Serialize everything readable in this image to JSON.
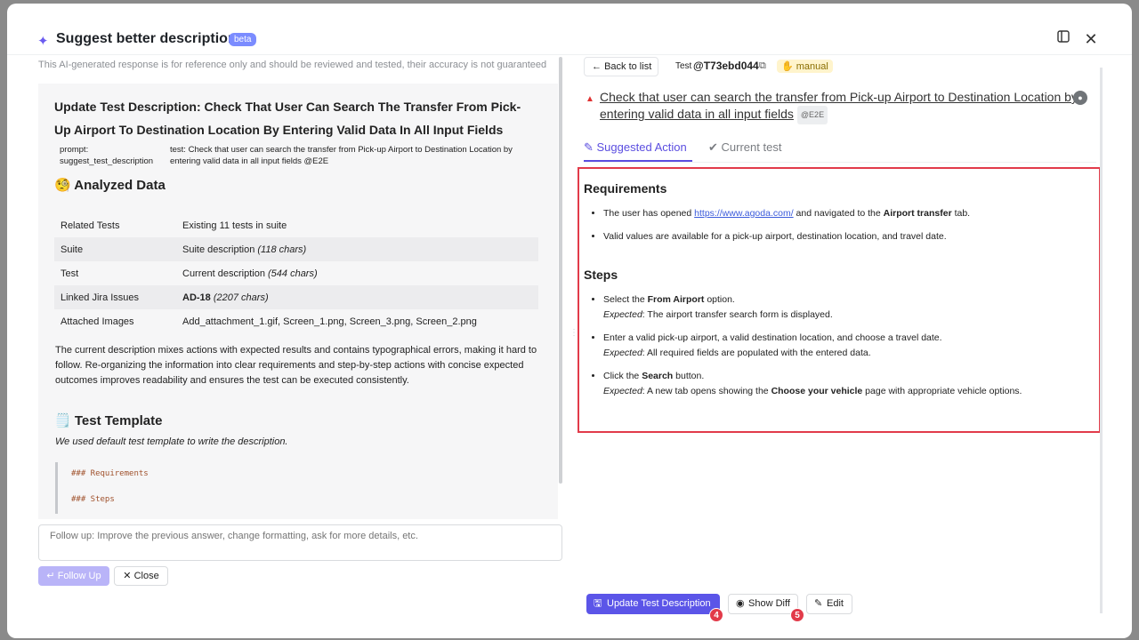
{
  "header": {
    "title": "Suggest better description",
    "beta_label": "beta",
    "panel_icon": "panel-icon",
    "close_icon": "close-icon"
  },
  "left": {
    "disclaimer": "This AI-generated response is for reference only and should be reviewed and tested, their accuracy is not guaranteed",
    "heading": "Update Test Description: Check That User Can Search The Transfer From Pick-Up Airport To Destination Location By Entering Valid Data In All Input Fields",
    "prompt_key": "prompt: suggest_test_description",
    "prompt_value": "test: Check that user can search the transfer from Pick-up Airport to Destination Location by entering valid data in all input fields @E2E",
    "analyzed_heading": "🧐 Analyzed Data",
    "table": [
      {
        "key": "Related Tests",
        "value": "Existing 11 tests in suite"
      },
      {
        "key": "Suite",
        "value": "Suite description",
        "note": "(118 chars)"
      },
      {
        "key": "Test",
        "value": "Current description",
        "note": "(544 chars)"
      },
      {
        "key": "Linked Jira Issues",
        "value": "AD-18",
        "note": "(2207 chars)"
      },
      {
        "key": "Attached Images",
        "value": "Add_attachment_1.gif, Screen_1.png, Screen_3.png, Screen_2.png"
      }
    ],
    "paragraph": "The current description mixes actions with expected results and contains typographical errors, making it hard to follow. Re-organizing the information into clear requirements and step-by-step actions with concise expected outcomes improves readability and ensures the test can be executed consistently.",
    "template_heading": "🗒️ Test Template",
    "template_note": "We used default test template to write the description.",
    "code_lines": [
      "### Requirements",
      "### Steps"
    ],
    "followup_placeholder": "Follow up: Improve the previous answer, change formatting, ask for more details, etc.",
    "follow_up_button": "Follow Up",
    "close_button": "Close"
  },
  "right": {
    "back_button": "Back to list",
    "test_label": "Test",
    "test_id": "@T73ebd044",
    "manual_tag": "manual",
    "test_title": "Check that user can search the transfer from Pick-up Airport to Destination Location by entering valid data in all input fields",
    "e2e_tag": "@E2E",
    "tabs": [
      "Suggested Action",
      "Current test"
    ],
    "requirements_heading": "Requirements",
    "req1_prefix": "The user has opened ",
    "req1_link": "https://www.agoda.com/",
    "req1_mid": " and navigated to the ",
    "req1_bold": "Airport transfer",
    "req1_suffix": " tab.",
    "req2": "Valid values are available for a pick-up airport, destination location, and travel date.",
    "steps_heading": "Steps",
    "step1_prefix": "Select the ",
    "step1_bold": "From Airport",
    "step1_suffix": " option.",
    "expected_label": "Expected",
    "step1_expected": ": The airport transfer search form is displayed.",
    "step2": "Enter a valid pick-up airport, a valid destination location, and choose a travel date.",
    "step2_expected": ": All required fields are populated with the entered data.",
    "step3_prefix": "Click the ",
    "step3_bold": "Search",
    "step3_suffix": " button.",
    "step3_expected_prefix": ": A new tab opens showing the ",
    "step3_expected_bold": "Choose your vehicle",
    "step3_expected_suffix": " page with appropriate vehicle options.",
    "update_button": "Update Test Description",
    "diff_button": "Show Diff",
    "edit_button": "Edit",
    "badge4": "4",
    "badge5": "5"
  },
  "colors": {
    "accent": "#5b55e8",
    "highlight_border": "#e23b4a",
    "beta_bg": "#7b8cff",
    "manual_bg": "#fff4cc"
  }
}
